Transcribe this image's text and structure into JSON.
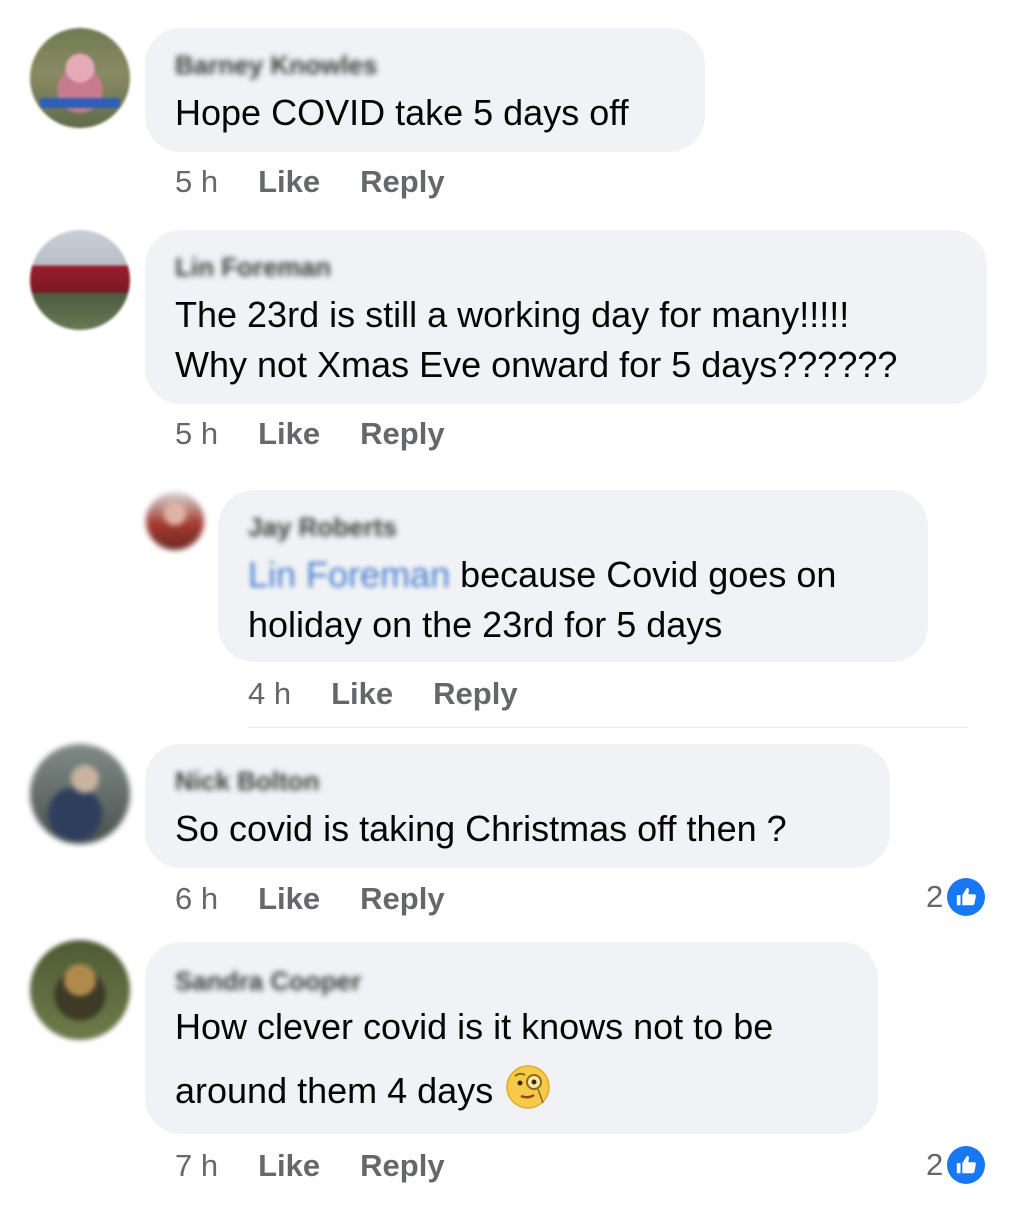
{
  "comments": [
    {
      "author": "Barney Knowles",
      "text_lines": [
        "Hope COVID take 5 days off"
      ],
      "time": "5 h",
      "like_label": "Like",
      "reply_label": "Reply"
    },
    {
      "author": "Lin Foreman",
      "text_lines": [
        "The 23rd is still a working day for many!!!!!",
        "Why not Xmas Eve onward for 5 days??????"
      ],
      "time": "5 h",
      "like_label": "Like",
      "reply_label": "Reply"
    },
    {
      "author": "Jay Roberts",
      "mention": "Lin Foreman",
      "text_lines": [
        "because Covid goes on",
        "holiday on the 23rd for 5 days"
      ],
      "time": "4 h",
      "like_label": "Like",
      "reply_label": "Reply"
    },
    {
      "author": "Nick Bolton",
      "text_lines": [
        "So covid is taking Christmas off then ?"
      ],
      "time": "6 h",
      "like_label": "Like",
      "reply_label": "Reply",
      "reaction_count": "2"
    },
    {
      "author": "Sandra Cooper",
      "text_lines": [
        "How clever covid is it knows not to be",
        "around them 4 days"
      ],
      "time": "7 h",
      "like_label": "Like",
      "reply_label": "Reply",
      "reaction_count": "2",
      "emoji": "face-with-monocle"
    }
  ],
  "colors": {
    "bubble": "#f0f2f5",
    "like_blue": "#1877f2",
    "meta_gray": "#65676b",
    "mention_blue": "#4a7fd0"
  }
}
